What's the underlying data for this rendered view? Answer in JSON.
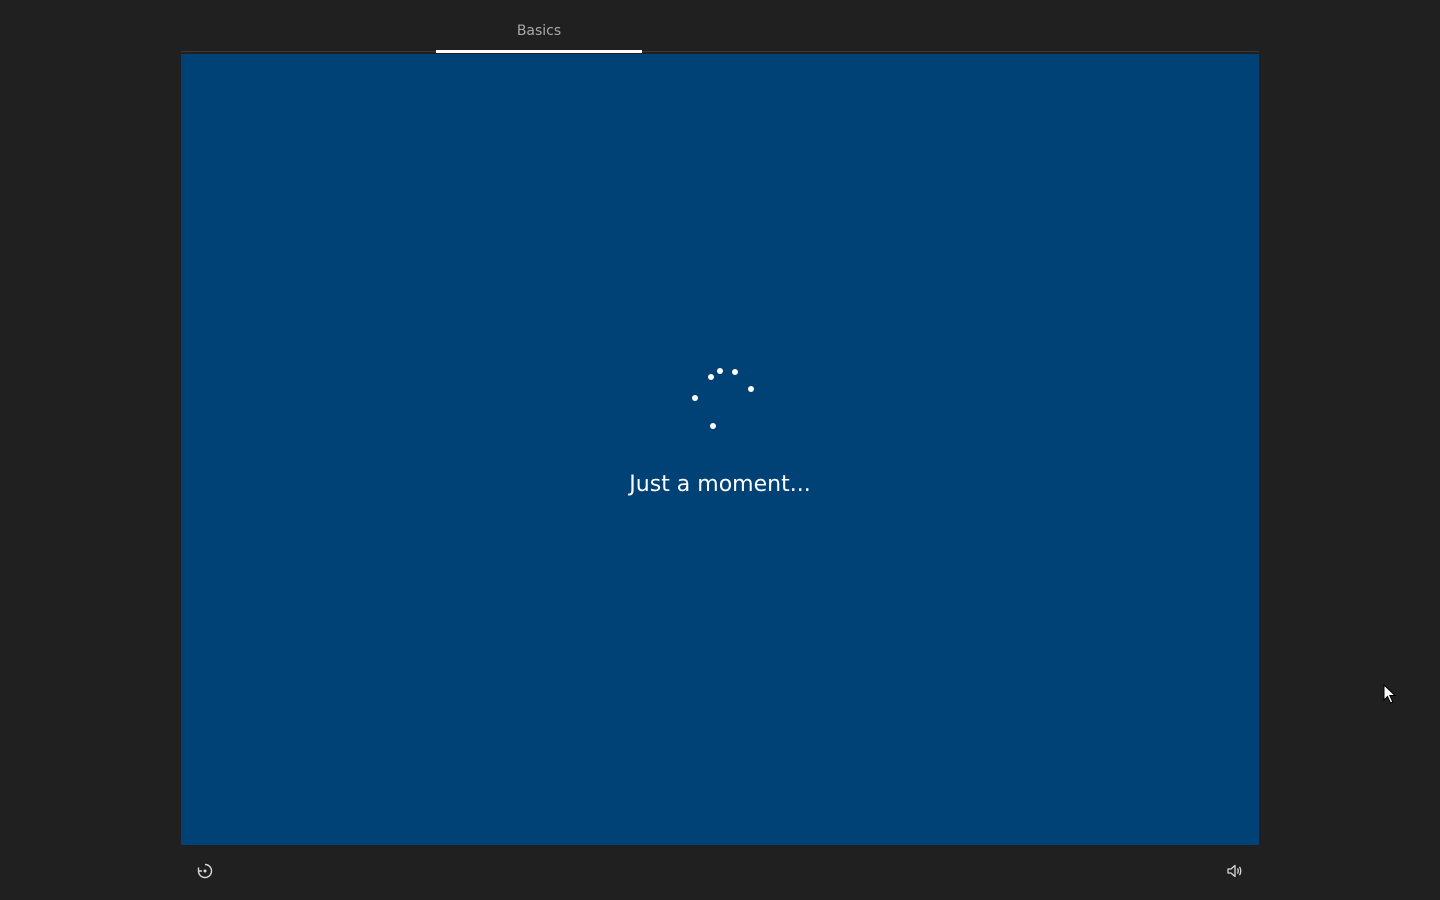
{
  "tabs": [
    {
      "label": "Basics",
      "active": true
    }
  ],
  "main": {
    "status_text": "Just a moment...",
    "background_color": "#004275"
  },
  "footer": {
    "left_icon": "ease-of-access-icon",
    "right_icon": "volume-icon"
  },
  "colors": {
    "chrome": "#202020",
    "panel": "#004275",
    "text": "#ffffff",
    "tab_text": "#a8a8a8"
  }
}
